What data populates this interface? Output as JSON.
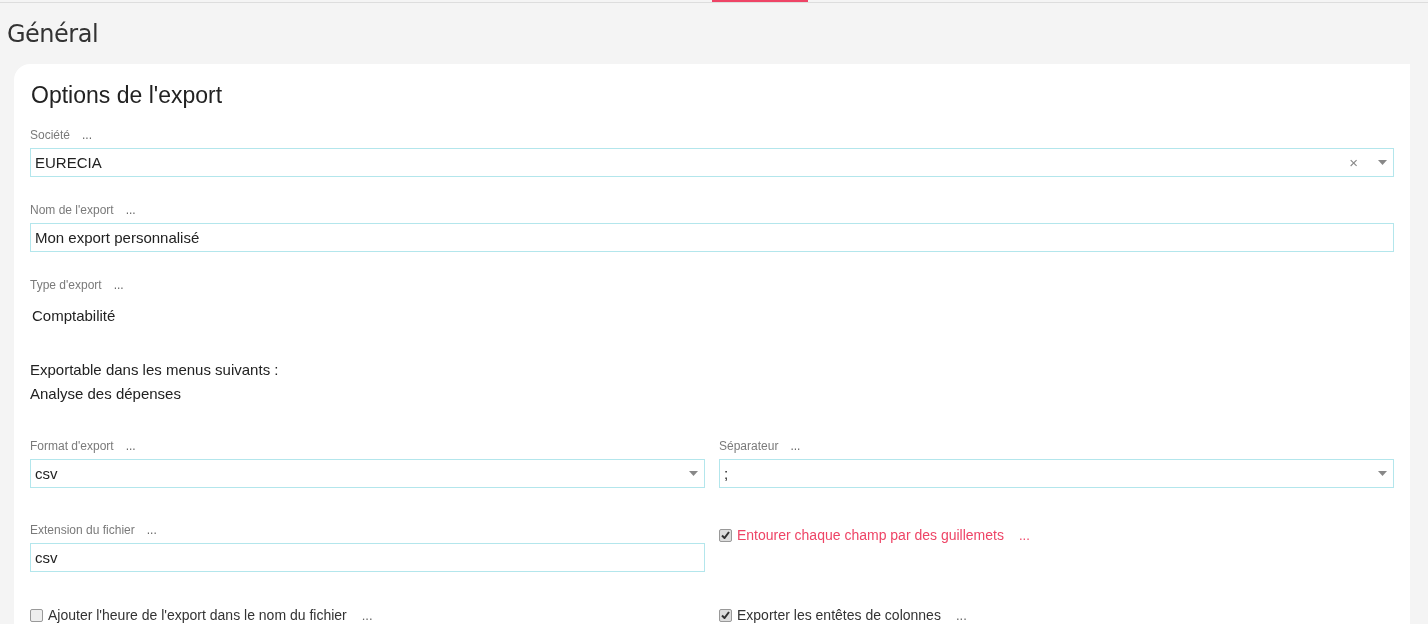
{
  "page_title": "Général",
  "card": {
    "title": "Options de l'export",
    "sections": [
      {
        "kind": "select",
        "label": "Société",
        "hint": "...",
        "value": "EURECIA",
        "clear": "×"
      },
      {
        "kind": "text",
        "label": "Nom de l'export",
        "hint": "...",
        "value": "Mon export personnalisé"
      },
      {
        "kind": "static",
        "label": "Type d'export",
        "hint": "...",
        "value": "Comptabilité"
      },
      {
        "kind": "info",
        "lines": [
          "Exportable dans les menus suivants :",
          "Analyse des dépenses"
        ]
      },
      {
        "kind": "row",
        "items": [
          {
            "kind": "select",
            "label": "Format d'export",
            "hint": "...",
            "value": "csv"
          },
          {
            "kind": "select",
            "label": "Séparateur",
            "hint": "...",
            "value": ";"
          }
        ]
      },
      {
        "kind": "row",
        "items": [
          {
            "kind": "text",
            "label": "Extension du fichier",
            "hint": "...",
            "value": "csv"
          },
          {
            "kind": "checkbox",
            "label": "Entourer chaque champ par des guillemets",
            "hint": "...",
            "checked": true,
            "highlighted": true
          }
        ]
      },
      {
        "kind": "row",
        "items": [
          {
            "kind": "checkbox",
            "label": "Ajouter l'heure de l'export dans le nom du fichier",
            "hint": "...",
            "checked": false,
            "highlighted": false
          },
          {
            "kind": "checkbox",
            "label": "Exporter les entêtes de colonnes",
            "hint": "...",
            "checked": true,
            "highlighted": false
          }
        ]
      }
    ]
  }
}
